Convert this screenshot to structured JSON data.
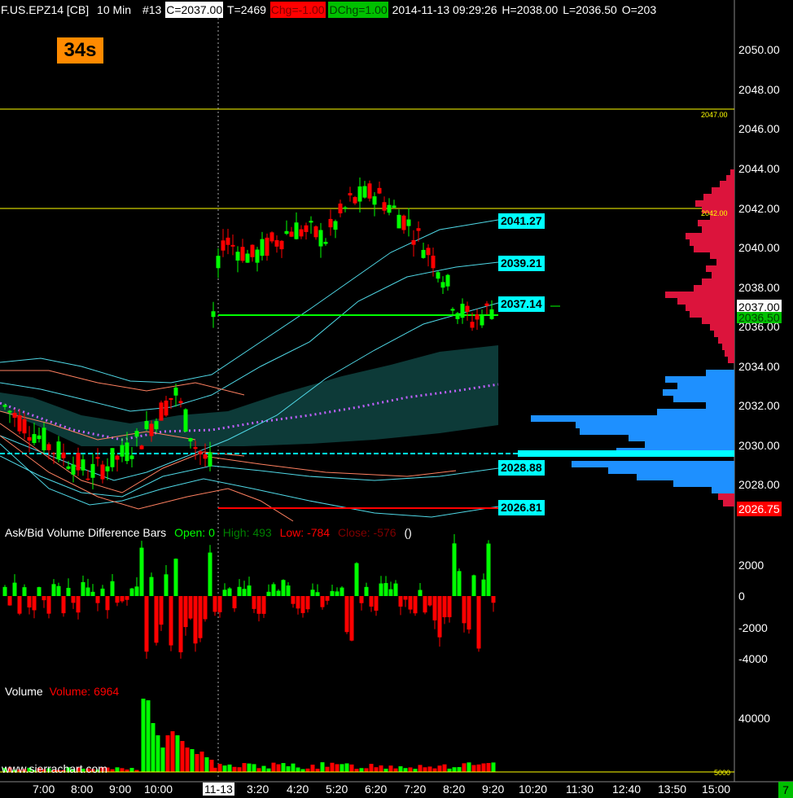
{
  "header": {
    "symbol": "F.US.EPZ14 [CB]",
    "interval": "10 Min",
    "number": "#13",
    "close": "C=2037.00",
    "trades": "T=2469",
    "chg": "Chg=-1.00",
    "dchg": "DChg=1.00",
    "datetime": "2014-11-13 09:29:26",
    "high": "H=2038.00",
    "low": "L=2036.50",
    "open": "O=203"
  },
  "bar_timer": "34s",
  "price_labels": {
    "a": "2041.27",
    "b": "2039.21",
    "c": "2037.14",
    "d": "2028.88",
    "e": "2026.81"
  },
  "right_tags": {
    "last": "2037.00",
    "bid": "2036.50",
    "low_tag": "2026.75",
    "line_high": "2047.00",
    "line_mid": "2042.00",
    "vol_ref": "5000"
  },
  "price_axis": [
    "2050.00",
    "2048.00",
    "2046.00",
    "2044.00",
    "2042.00",
    "2040.00",
    "2038.00",
    "2036.00",
    "2034.00",
    "2032.00",
    "2030.00",
    "2028.00"
  ],
  "delta_panel": {
    "title": "Ask/Bid Volume Difference Bars",
    "open": "Open: 0",
    "high": "High: 493",
    "low": "Low: -784",
    "close": "Close: -576",
    "extra": "()"
  },
  "delta_axis": [
    "2000",
    "0",
    "-2000",
    "-4000"
  ],
  "volume_panel": {
    "title": "Volume",
    "value": "Volume: 6964"
  },
  "volume_axis": [
    "40000"
  ],
  "watermark": "www.sierrachart.com",
  "time_axis": [
    "7:00",
    "8:00",
    "9:00",
    "10:00",
    "11-13",
    "3:20",
    "4:20",
    "5:20",
    "6:20",
    "7:20",
    "8:20",
    "9:20",
    "10:20",
    "11:30",
    "12:40",
    "13:50",
    "15:00"
  ],
  "corner": "7",
  "colors": {
    "up": "#00ff00",
    "down": "#ff0000",
    "cyan": "#00ffff",
    "orange": "#ff8a00",
    "band": "#0d3a38",
    "profile_up": "#dc143c",
    "profile_down": "#1e90ff"
  }
}
